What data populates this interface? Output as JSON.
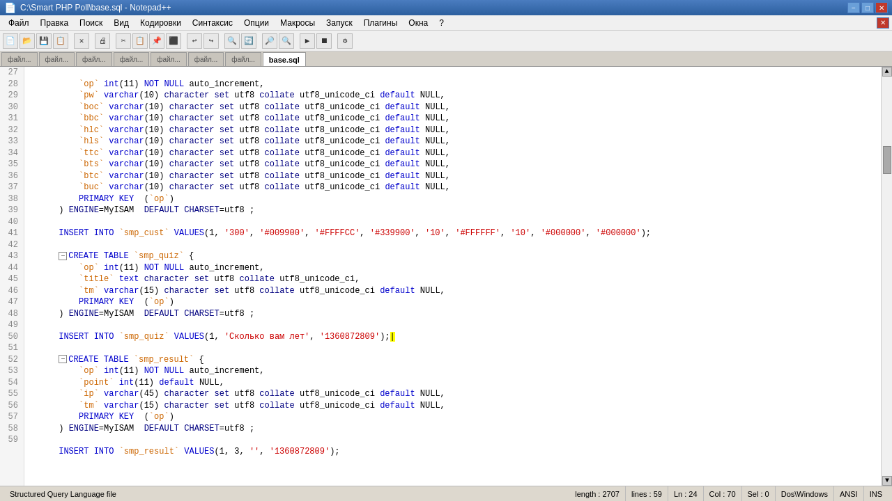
{
  "titlebar": {
    "title": "C:\\Smart PHP Poll\\base.sql - Notepad++",
    "minimize": "−",
    "maximize": "□",
    "close": "✕"
  },
  "menubar": {
    "items": [
      "Файл",
      "Правка",
      "Поиск",
      "Вид",
      "Кодировки",
      "Синтаксис",
      "Опции",
      "Макросы",
      "Запуск",
      "Плагины",
      "Окна",
      "?"
    ]
  },
  "tabs": [
    {
      "label": "...",
      "active": false
    },
    {
      "label": "...",
      "active": false
    },
    {
      "label": "...",
      "active": false
    },
    {
      "label": "...",
      "active": false
    },
    {
      "label": "...",
      "active": false
    },
    {
      "label": "...",
      "active": false
    },
    {
      "label": "...",
      "active": false
    },
    {
      "label": "base.sql",
      "active": true
    }
  ],
  "statusbar": {
    "file_type": "Structured Query Language file",
    "length": "length : 2707",
    "lines": "lines : 59",
    "ln": "Ln : 24",
    "col": "Col : 70",
    "sel": "Sel : 0",
    "dos": "Dos\\Windows",
    "encoding": "ANSI",
    "ins": "INS"
  },
  "lines": [
    {
      "num": 27,
      "content": "    `op` int(11) NOT NULL auto_increment,",
      "fold": false
    },
    {
      "num": 28,
      "content": "    `pw` varchar(10) character set utf8 collate utf8_unicode_ci default NULL,",
      "fold": false
    },
    {
      "num": 29,
      "content": "    `boc` varchar(10) character set utf8 collate utf8_unicode_ci default NULL,",
      "fold": false
    },
    {
      "num": 30,
      "content": "    `bbc` varchar(10) character set utf8 collate utf8_unicode_ci default NULL,",
      "fold": false
    },
    {
      "num": 31,
      "content": "    `hlc` varchar(10) character set utf8 collate utf8_unicode_ci default NULL,",
      "fold": false
    },
    {
      "num": 32,
      "content": "    `hls` varchar(10) character set utf8 collate utf8_unicode_ci default NULL,",
      "fold": false
    },
    {
      "num": 33,
      "content": "    `ttc` varchar(10) character set utf8 collate utf8_unicode_ci default NULL,",
      "fold": false
    },
    {
      "num": 34,
      "content": "    `bts` varchar(10) character set utf8 collate utf8_unicode_ci default NULL,",
      "fold": false
    },
    {
      "num": 35,
      "content": "    `btc` varchar(10) character set utf8 collate utf8_unicode_ci default NULL,",
      "fold": false
    },
    {
      "num": 36,
      "content": "    `buc` varchar(10) character set utf8 collate utf8_unicode_ci default NULL,",
      "fold": false
    },
    {
      "num": 37,
      "content": "    PRIMARY KEY  (`op`)",
      "fold": false
    },
    {
      "num": 38,
      "content": ") ENGINE=MyISAM  DEFAULT CHARSET=utf8 ;",
      "fold": false
    },
    {
      "num": 39,
      "content": "",
      "fold": false
    },
    {
      "num": 40,
      "content": "INSERT INTO `smp_cust` VALUES(1, '300', '#009900', '#FFFFCC', '#339900', '10', '#FFFFFF', '10', '#000000', '#000000');",
      "fold": false
    },
    {
      "num": 41,
      "content": "",
      "fold": false
    },
    {
      "num": 42,
      "content": "CREATE TABLE `smp_quiz` {",
      "fold": true
    },
    {
      "num": 43,
      "content": "    `op` int(11) NOT NULL auto_increment,",
      "fold": false
    },
    {
      "num": 44,
      "content": "    `title` text character set utf8 collate utf8_unicode_ci,",
      "fold": false
    },
    {
      "num": 45,
      "content": "    `tm` varchar(15) character set utf8 collate utf8_unicode_ci default NULL,",
      "fold": false
    },
    {
      "num": 46,
      "content": "    PRIMARY KEY  (`op`)",
      "fold": false
    },
    {
      "num": 47,
      "content": ") ENGINE=MyISAM  DEFAULT CHARSET=utf8 ;",
      "fold": false
    },
    {
      "num": 48,
      "content": "",
      "fold": false
    },
    {
      "num": 49,
      "content": "INSERT INTO `smp_quiz` VALUES(1, 'Сколько вам лет', '1360872809');",
      "fold": false
    },
    {
      "num": 50,
      "content": "",
      "fold": false
    },
    {
      "num": 51,
      "content": "CREATE TABLE `smp_result` {",
      "fold": true
    },
    {
      "num": 52,
      "content": "    `op` int(11) NOT NULL auto_increment,",
      "fold": false
    },
    {
      "num": 53,
      "content": "    `point` int(11) default NULL,",
      "fold": false
    },
    {
      "num": 54,
      "content": "    `ip` varchar(45) character set utf8 collate utf8_unicode_ci default NULL,",
      "fold": false
    },
    {
      "num": 55,
      "content": "    `tm` varchar(15) character set utf8 collate utf8_unicode_ci default NULL,",
      "fold": false
    },
    {
      "num": 56,
      "content": "    PRIMARY KEY  (`op`)",
      "fold": false
    },
    {
      "num": 57,
      "content": ") ENGINE=MyISAM  DEFAULT CHARSET=utf8 ;",
      "fold": false
    },
    {
      "num": 58,
      "content": "",
      "fold": false
    },
    {
      "num": 59,
      "content": "INSERT INTO `smp_result` VALUES(1, 3, '', '1360872809');",
      "fold": false
    }
  ]
}
